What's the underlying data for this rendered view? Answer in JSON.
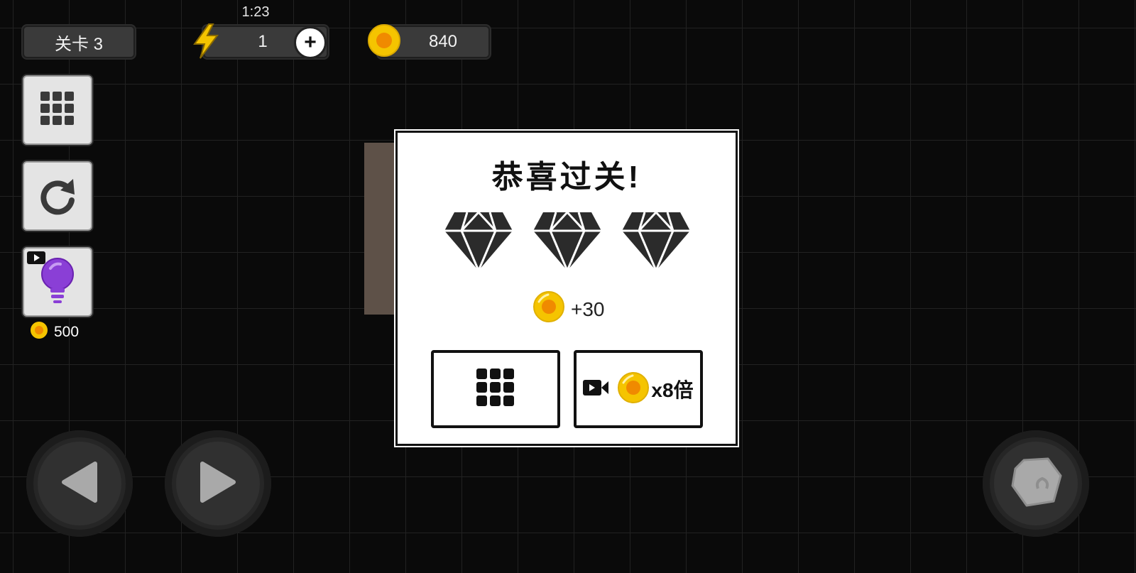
{
  "hud": {
    "timer": "1:23",
    "level_label": "关卡 3",
    "energy": "1",
    "coins": "840"
  },
  "sidebar": {
    "hint_cost": "500"
  },
  "dialog": {
    "title": "恭喜过关!",
    "diamonds_earned": 3,
    "diamonds_total": 3,
    "reward_text": "+30",
    "multiplier_text": "x8倍"
  },
  "icons": {
    "energy": "lightning-bolt-icon",
    "coin": "gold-coin-icon",
    "plus": "plus-icon",
    "levels": "grid-menu-icon",
    "restart": "restart-arrow-icon",
    "hint": "lightbulb-icon",
    "video": "video-camera-icon",
    "diamond": "diamond-icon",
    "left": "left-arrow-icon",
    "right": "right-arrow-icon",
    "jump": "rock-icon"
  },
  "colors": {
    "coin": "#f5c400",
    "coin_core": "#f08a00",
    "bolt": "#f5c400",
    "bulb": "#8a3fd6",
    "crate": "#5e5148"
  }
}
